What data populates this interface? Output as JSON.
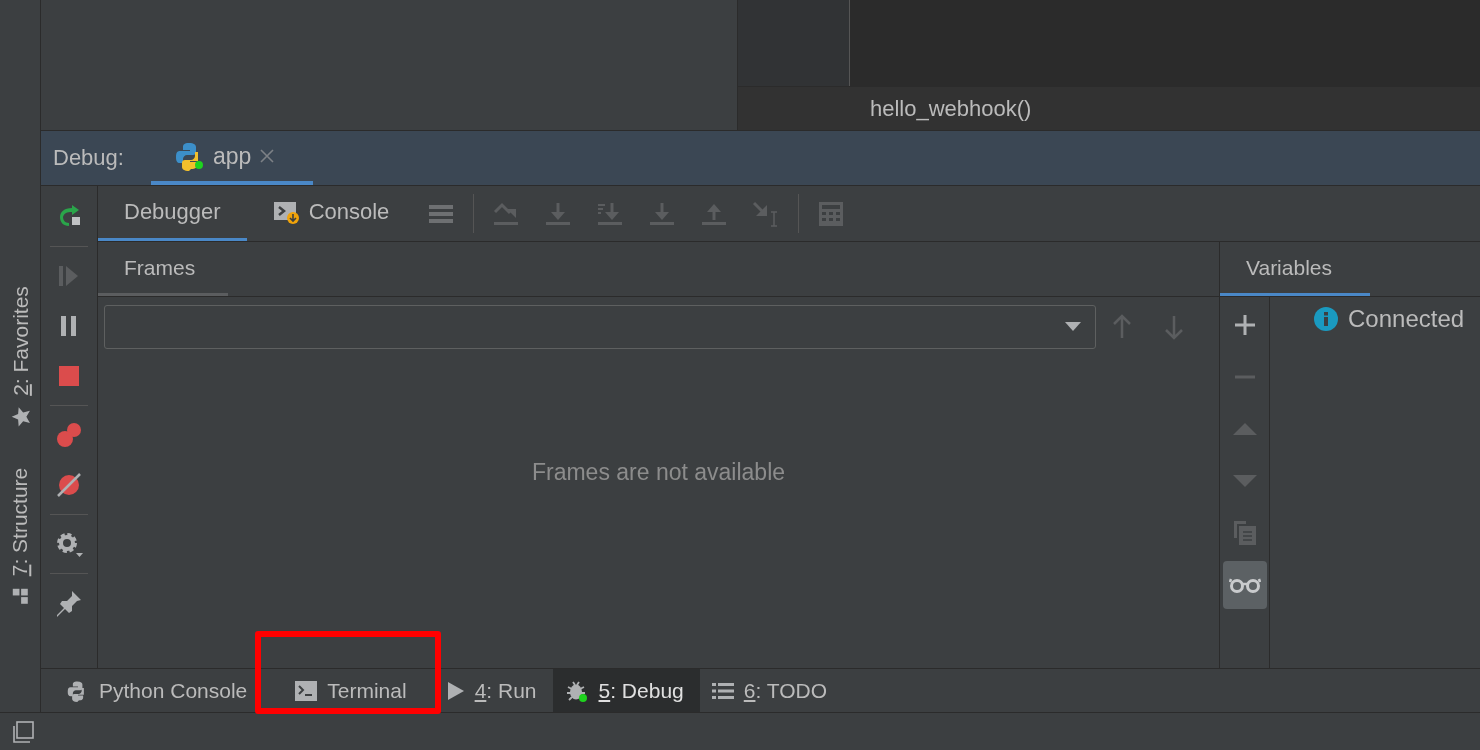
{
  "side_stripe": [
    {
      "label": "2: Favorites",
      "kind": "favorites",
      "mnemonic": true
    },
    {
      "label": "7: Structure",
      "kind": "structure",
      "mnemonic": true
    }
  ],
  "editor": {
    "breadcrumb": "hello_webhook()"
  },
  "debug": {
    "title": "Debug:",
    "session_tabs": [
      {
        "label": "app",
        "selected": true
      }
    ]
  },
  "session_controls": [
    [
      {
        "kind": "rerun",
        "disabled": false
      }
    ],
    [
      {
        "kind": "resume",
        "disabled": true
      },
      {
        "kind": "pause",
        "disabled": false
      },
      {
        "kind": "stop",
        "disabled": false
      }
    ],
    [
      {
        "kind": "breakpoints",
        "disabled": false
      },
      {
        "kind": "mute",
        "disabled": false
      }
    ],
    [
      {
        "kind": "settings",
        "disabled": false
      }
    ],
    [
      {
        "kind": "pin",
        "disabled": false
      }
    ]
  ],
  "tabs": [
    {
      "label": "Debugger",
      "kind": "debugger",
      "selected": true
    },
    {
      "label": "Console",
      "kind": "console",
      "selected": false
    }
  ],
  "step_actions": [
    [
      {
        "kind": "layout",
        "disabled": false
      }
    ],
    [
      {
        "kind": "step-over",
        "disabled": true
      },
      {
        "kind": "step-into",
        "disabled": true
      },
      {
        "kind": "step-into-my",
        "disabled": true
      },
      {
        "kind": "force-step",
        "disabled": true
      },
      {
        "kind": "step-out",
        "disabled": true
      },
      {
        "kind": "run-to-cursor",
        "disabled": true
      }
    ],
    [
      {
        "kind": "evaluate",
        "disabled": true
      }
    ]
  ],
  "frames": {
    "tab": "Frames",
    "empty_text": "Frames are not available",
    "nav": [
      {
        "kind": "up",
        "disabled": true
      },
      {
        "kind": "down",
        "disabled": true
      }
    ]
  },
  "variables": {
    "tab": "Variables",
    "message": "Connected",
    "tools": [
      {
        "kind": "add",
        "disabled": false,
        "selected": false
      },
      {
        "kind": "remove",
        "disabled": true,
        "selected": false
      },
      {
        "kind": "up",
        "disabled": true,
        "selected": false
      },
      {
        "kind": "down",
        "disabled": true,
        "selected": false
      },
      {
        "kind": "copy",
        "disabled": true,
        "selected": false
      },
      {
        "kind": "watches",
        "disabled": false,
        "selected": true
      }
    ]
  },
  "tool_windows": [
    {
      "label": "Python Console",
      "kind": "python",
      "mnemonic": false,
      "selected": false,
      "highlighted": false
    },
    {
      "label": "Terminal",
      "kind": "terminal",
      "mnemonic": false,
      "selected": false,
      "highlighted": true
    },
    {
      "label": "4: Run",
      "kind": "run",
      "mnemonic": true,
      "selected": false,
      "highlighted": false
    },
    {
      "label": "5: Debug",
      "kind": "debug",
      "mnemonic": true,
      "selected": true,
      "highlighted": false
    },
    {
      "label": "6: TODO",
      "kind": "todo",
      "mnemonic": true,
      "selected": false,
      "highlighted": false
    }
  ]
}
